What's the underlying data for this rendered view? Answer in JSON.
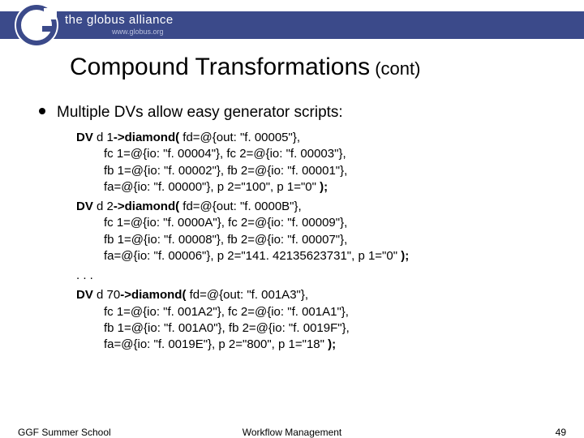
{
  "logo": {
    "brand": "the globus alliance",
    "url": "www.globus.org"
  },
  "title": {
    "main": "Compound Transformations",
    "suffix": "(cont)"
  },
  "bullet": "Multiple DVs allow easy generator scripts:",
  "code": {
    "block1": {
      "head_b1": "DV",
      "head_t1": " d 1",
      "head_b2": "->diamond(",
      "head_t2": " fd=@{out: \"f. 00005\"},",
      "l2": "fc 1=@{io: \"f. 00004\"}, fc 2=@{io: \"f. 00003\"},",
      "l3": "fb 1=@{io: \"f. 00002\"}, fb 2=@{io: \"f. 00001\"},",
      "l4_t": "fa=@{io: \"f. 00000\"}, p 2=\"100\", p 1=\"0\" ",
      "l4_b": ");"
    },
    "block2": {
      "head_b1": "DV",
      "head_t1": " d 2",
      "head_b2": "->diamond(",
      "head_t2": " fd=@{out: \"f. 0000B\"},",
      "l2": "fc 1=@{io: \"f. 0000A\"}, fc 2=@{io: \"f. 00009\"},",
      "l3": "fb 1=@{io: \"f. 00008\"}, fb 2=@{io: \"f. 00007\"},",
      "l4_t": "fa=@{io: \"f. 00006\"}, p 2=\"141. 42135623731\", p 1=\"0\" ",
      "l4_b": ");"
    },
    "ellipsis": ". . .",
    "block3": {
      "head_b1": "DV",
      "head_t1": " d 70",
      "head_b2": "->diamond(",
      "head_t2": " fd=@{out: \"f. 001A3\"},",
      "l2": "fc 1=@{io: \"f. 001A2\"}, fc 2=@{io: \"f. 001A1\"},",
      "l3": "fb 1=@{io: \"f. 001A0\"}, fb 2=@{io: \"f. 0019F\"},",
      "l4_t": "fa=@{io: \"f. 0019E\"}, p 2=\"800\", p 1=\"18\" ",
      "l4_b": ");"
    }
  },
  "footer": {
    "left": "GGF Summer School",
    "center": "Workflow Management",
    "right": "49"
  }
}
